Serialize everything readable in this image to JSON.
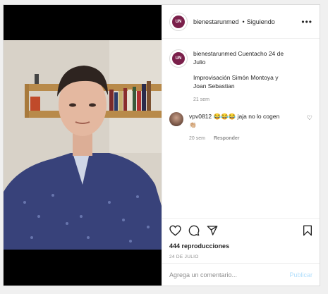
{
  "header": {
    "username": "bienestarunmed",
    "separator": "•",
    "follow_status": "Siguiendo",
    "avatar_initials": "UN"
  },
  "caption": {
    "username": "bienestarunmed",
    "line1": "Cuentacho 24 de",
    "line2": "Julio",
    "line3": "Improvisación Simón Montoya y",
    "line4": "Joan Sebastian",
    "time": "21 sem"
  },
  "comment": {
    "username": "vpv0812",
    "text": "😂😂😂 jaja no lo cogen",
    "text2": "👏🏼",
    "time": "20 sem",
    "reply_label": "Responder"
  },
  "stats": {
    "views": "444 reproducciones",
    "date": "24 DE JULIO"
  },
  "add_comment": {
    "placeholder": "Agrega un comentario...",
    "post_label": "Publicar"
  },
  "icons": {
    "like": "heart-icon",
    "comment": "comment-icon",
    "share": "paper-plane-icon",
    "save": "bookmark-icon",
    "more": "more-dots-icon"
  }
}
